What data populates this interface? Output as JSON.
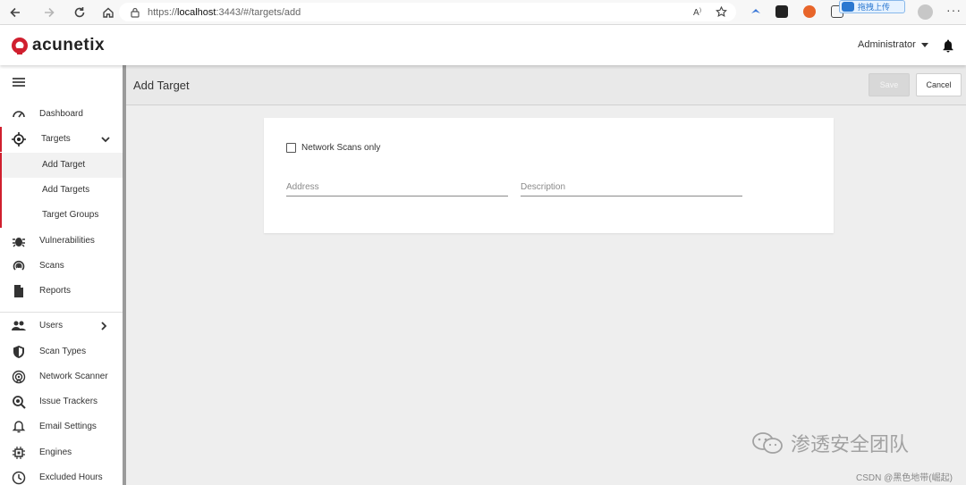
{
  "browser": {
    "url_scheme": "https://",
    "url_host": "localhost",
    "url_path": ":3443/#/targets/add",
    "upload_tip": "拖拽上传",
    "more_label": "···"
  },
  "header": {
    "logo_text": "acunetix",
    "user": "Administrator"
  },
  "sidebar": {
    "items": [
      {
        "label": "Dashboard",
        "icon": "speedometer-icon"
      },
      {
        "label": "Targets",
        "icon": "crosshair-icon"
      },
      {
        "label": "Vulnerabilities",
        "icon": "bug-icon"
      },
      {
        "label": "Scans",
        "icon": "radar-icon"
      },
      {
        "label": "Reports",
        "icon": "document-icon"
      },
      {
        "label": "Users",
        "icon": "users-icon"
      },
      {
        "label": "Scan Types",
        "icon": "shield-icon"
      },
      {
        "label": "Network Scanner",
        "icon": "network-scanner-icon"
      },
      {
        "label": "Issue Trackers",
        "icon": "magnifier-bug-icon"
      },
      {
        "label": "Email Settings",
        "icon": "bell-outline-icon"
      },
      {
        "label": "Engines",
        "icon": "chip-icon"
      },
      {
        "label": "Excluded Hours",
        "icon": "clock-icon"
      }
    ],
    "targets_sub": [
      {
        "label": "Add Target"
      },
      {
        "label": "Add Targets"
      },
      {
        "label": "Target Groups"
      }
    ]
  },
  "page": {
    "title": "Add Target",
    "save_label": "Save",
    "cancel_label": "Cancel"
  },
  "form": {
    "network_scans_label": "Network Scans only",
    "network_scans_checked": false,
    "address_placeholder": "Address",
    "address_value": "",
    "description_placeholder": "Description",
    "description_value": ""
  },
  "watermark": {
    "main": "渗透安全团队",
    "small": "CSDN @黑色地带(崛起)"
  },
  "colors": {
    "brand": "#d01f2e",
    "save_disabled": "#d8d8d8"
  }
}
